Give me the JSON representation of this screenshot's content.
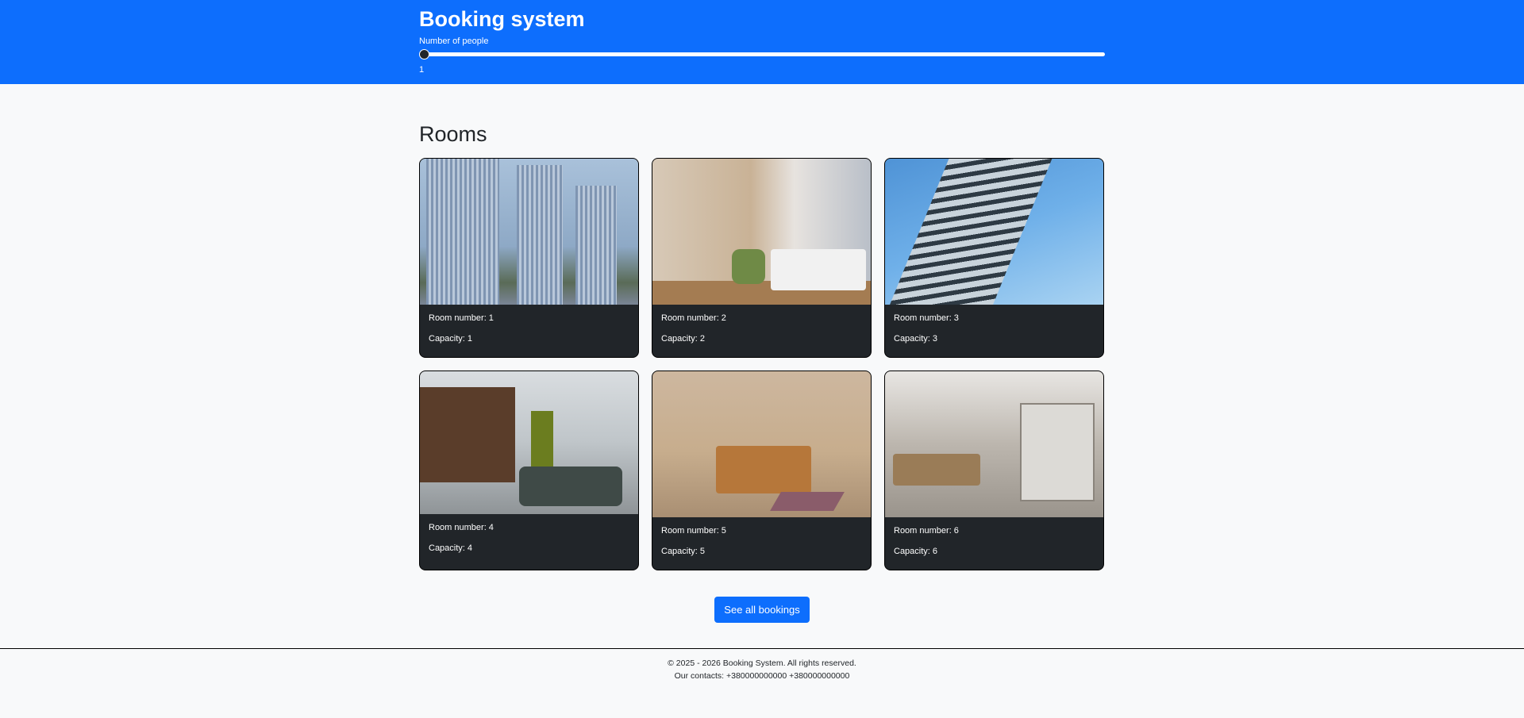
{
  "header": {
    "title": "Booking system",
    "people_label": "Number of people",
    "people_value": "1",
    "slider_fraction": 0.0
  },
  "main": {
    "heading": "Rooms",
    "rooms": [
      {
        "room_label": "Room number: 1",
        "capacity_label": "Capacity: 1"
      },
      {
        "room_label": "Room number: 2",
        "capacity_label": "Capacity: 2"
      },
      {
        "room_label": "Room number: 3",
        "capacity_label": "Capacity: 3"
      },
      {
        "room_label": "Room number: 4",
        "capacity_label": "Capacity: 4"
      },
      {
        "room_label": "Room number: 5",
        "capacity_label": "Capacity: 5"
      },
      {
        "room_label": "Room number: 6",
        "capacity_label": "Capacity: 6"
      }
    ],
    "bookings_button": "See all bookings"
  },
  "footer": {
    "copyright": "© 2025 - 2026 Booking System. All rights reserved.",
    "contacts": "Our contacts: +380000000000 +380000000000"
  },
  "colors": {
    "primary": "#0d6efd",
    "card_bg": "#212529",
    "page_bg": "#f8f9fa"
  }
}
